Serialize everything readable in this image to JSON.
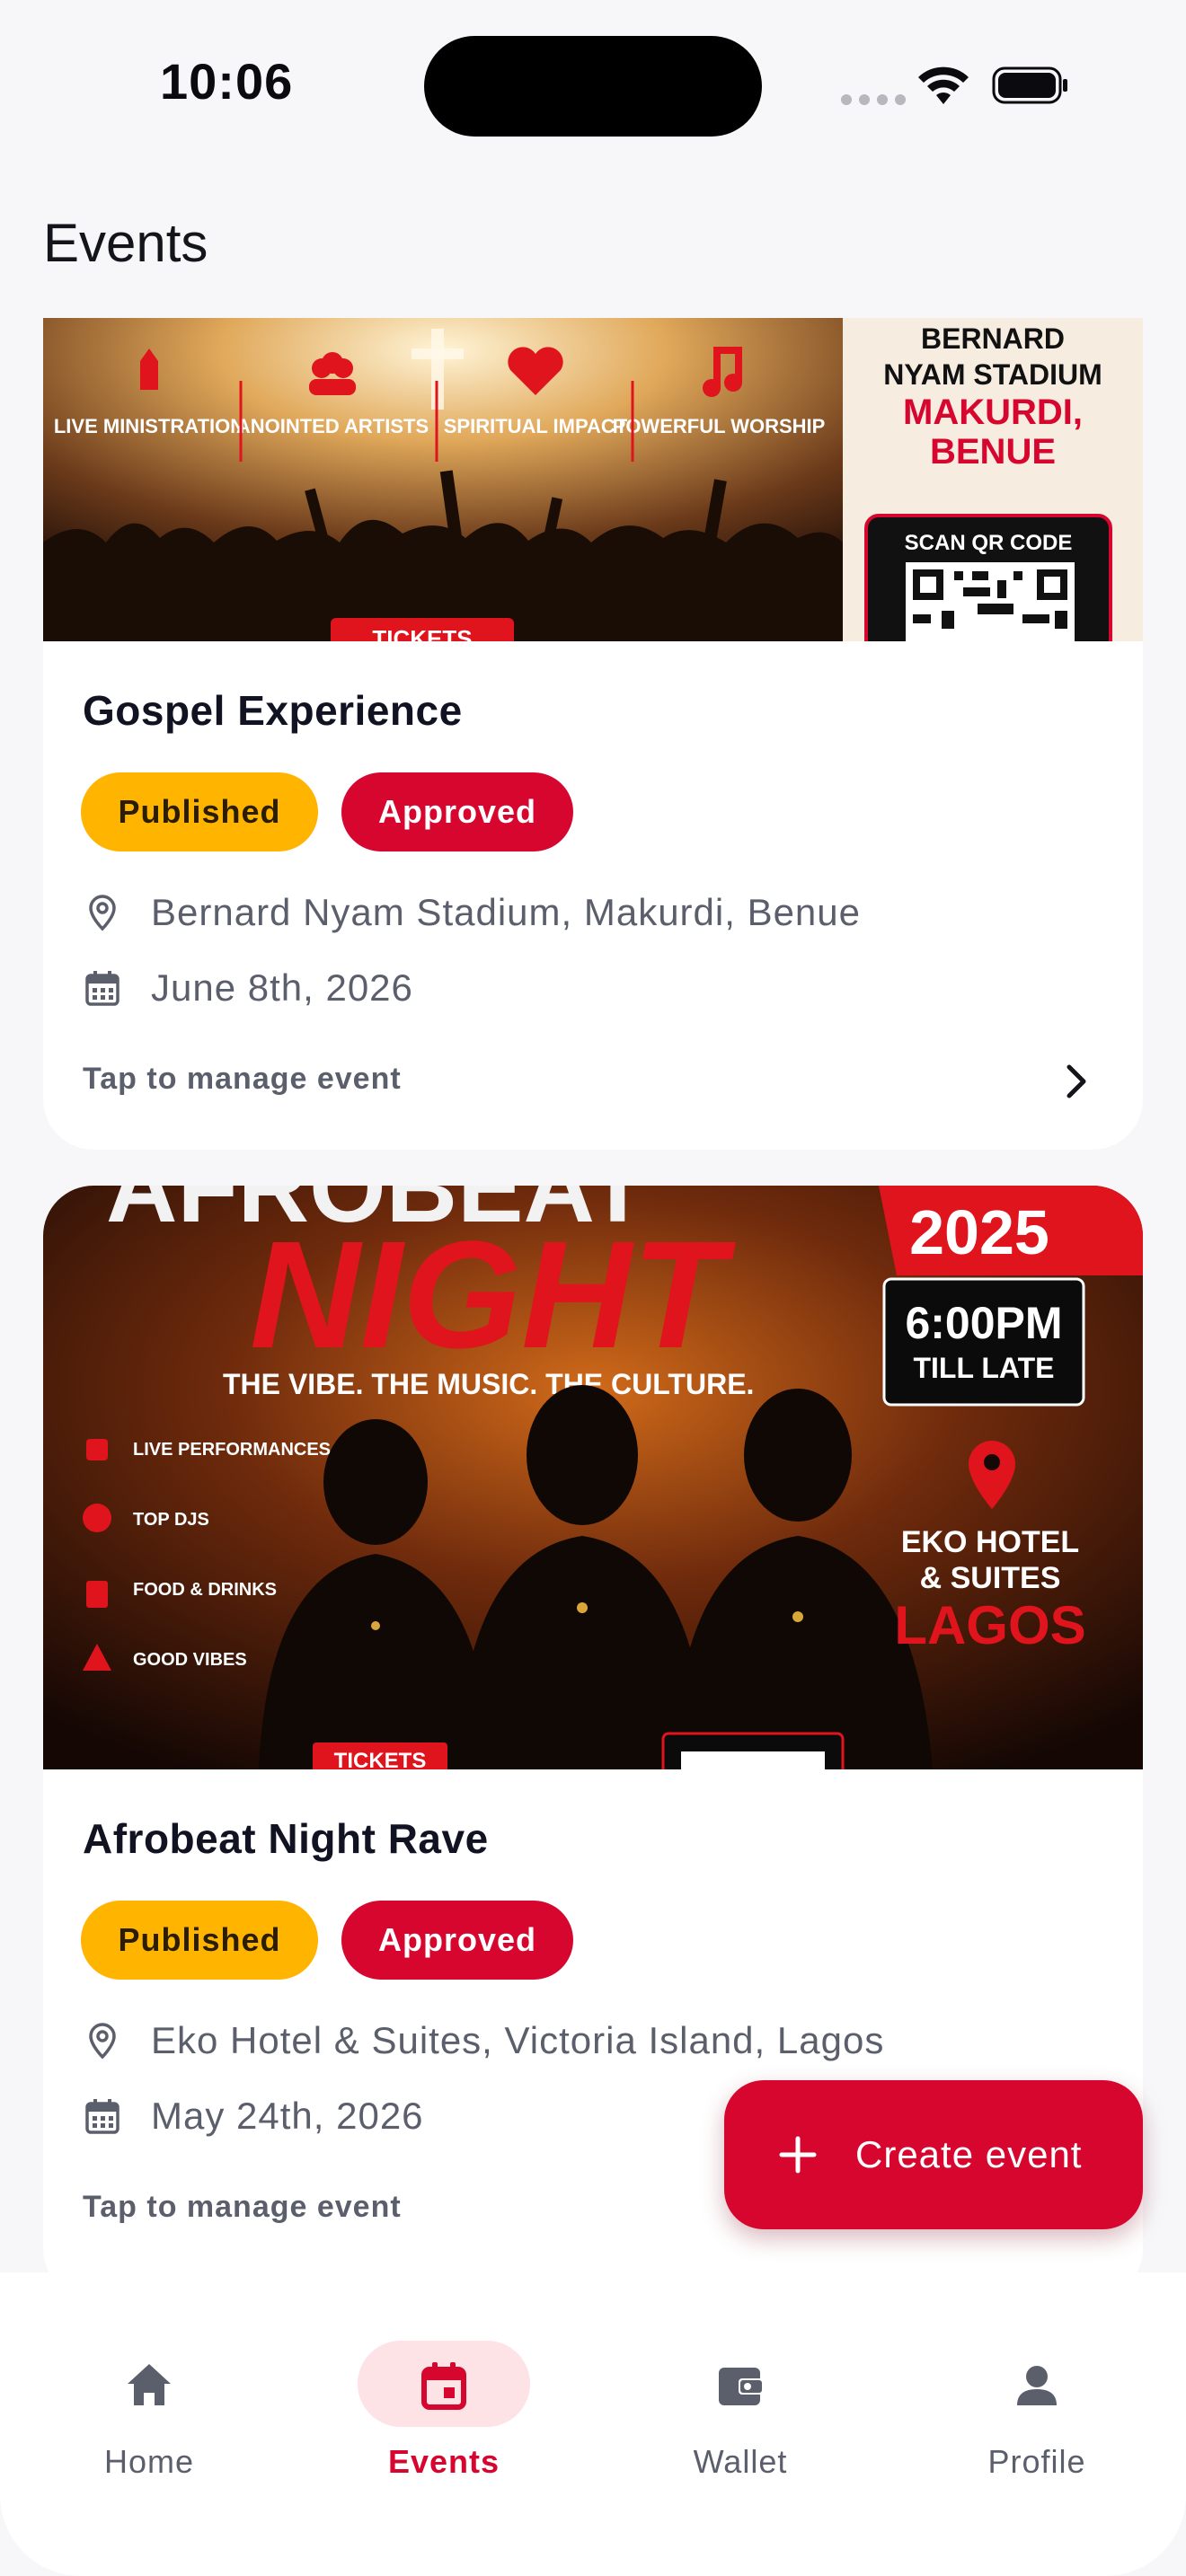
{
  "status": {
    "time": "10:06"
  },
  "page_title": "Events",
  "events": [
    {
      "title": "Gospel Experience",
      "badges": [
        "Published",
        "Approved"
      ],
      "location": "Bernard Nyam Stadium, Makurdi, Benue",
      "date": "June 8th, 2026",
      "manage_label": "Tap to manage event",
      "banner": {
        "features": [
          "LIVE MINISTRATION",
          "ANOINTED ARTISTS",
          "SPIRITUAL IMPACT",
          "POWERFUL WORSHIP"
        ],
        "venue_line1": "BERNARD",
        "venue_line2": "NYAM STADIUM",
        "city": "MAKURDI,",
        "state": "BENUE",
        "qr_label": "SCAN QR CODE",
        "tickets": "TICKETS"
      }
    },
    {
      "title": "Afrobeat Night Rave",
      "badges": [
        "Published",
        "Approved"
      ],
      "location": "Eko Hotel & Suites, Victoria Island, Lagos",
      "date": "May 24th, 2026",
      "manage_label": "Tap to manage event",
      "banner": {
        "headline": "NIGHT",
        "tagline": "THE VIBE. THE MUSIC. THE CULTURE.",
        "year": "2025",
        "time": "6:00PM",
        "time_sub": "TILL LATE",
        "venue_line1": "EKO HOTEL",
        "venue_line2": "& SUITES",
        "city": "LAGOS",
        "features": [
          "LIVE PERFORMANCES",
          "TOP DJS",
          "FOOD & DRINKS",
          "GOOD VIBES"
        ],
        "tickets": "TICKETS"
      }
    }
  ],
  "fab": {
    "label": "Create event"
  },
  "nav": {
    "items": [
      {
        "label": "Home",
        "icon": "home-icon"
      },
      {
        "label": "Events",
        "icon": "calendar-icon"
      },
      {
        "label": "Wallet",
        "icon": "wallet-icon"
      },
      {
        "label": "Profile",
        "icon": "profile-icon"
      }
    ],
    "active": "Events"
  },
  "colors": {
    "accent": "#d6062f",
    "published": "#ffb400",
    "text": "#111322",
    "muted": "#5b5f6c"
  }
}
